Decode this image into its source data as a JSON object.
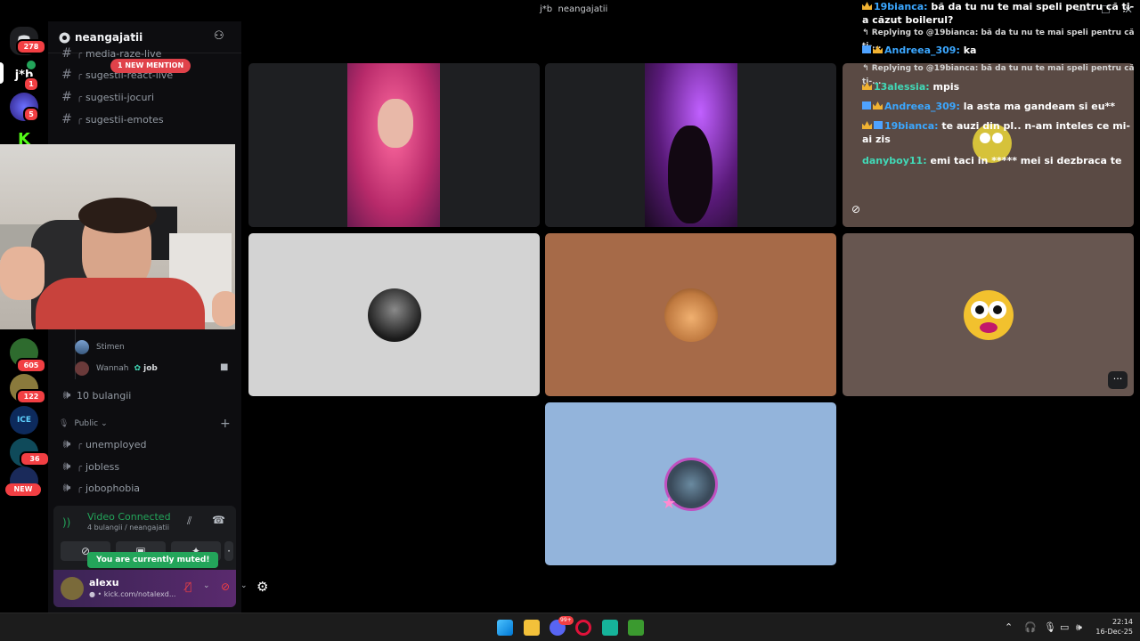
{
  "window": {
    "title": "neangajatii",
    "title_prefix": "j*b"
  },
  "rail": {
    "home_badge": "278",
    "servers": [
      {
        "label": "j*b",
        "badge": "1"
      },
      {
        "label": "",
        "badge": "5"
      },
      {
        "label": "K",
        "badge": ""
      },
      {
        "label": "",
        "badge": "605"
      },
      {
        "label": "",
        "badge": "122"
      },
      {
        "label": "ICE",
        "badge": ""
      },
      {
        "label": "",
        "badge": "36"
      }
    ],
    "new_label": "NEW"
  },
  "sidebar": {
    "server_name": "neangajatii",
    "mention_badge": "1 NEW MENTION",
    "channels": [
      {
        "name": "media-raze-live"
      },
      {
        "name": "sugestii-react-live"
      },
      {
        "name": "sugestii-jocuri"
      },
      {
        "name": "sugestii-emotes"
      }
    ],
    "voice_members": [
      {
        "name": "Stimen",
        "tag": ""
      },
      {
        "name": "Wannah",
        "tag": "job"
      }
    ],
    "voice_channel": "10 bulangii",
    "public_category": "Public",
    "public_channels": [
      {
        "name": "unemployed"
      },
      {
        "name": "jobless"
      },
      {
        "name": "jobophobia"
      }
    ]
  },
  "voice_panel": {
    "status": "Video Connected",
    "location": "4 bulangii / neangajatii",
    "tooltip": "You are currently muted!"
  },
  "user_panel": {
    "username": "alexu",
    "status": "kick.com/notalexd..."
  },
  "chat": {
    "lines": [
      {
        "type": "msg",
        "nick": "19bianca:",
        "text": "bă da tu nu te mai speli pentru că ți-a căzut boilerul?"
      },
      {
        "type": "reply",
        "text": "Replying to @19bianca: bă da tu nu te mai speli pentru că ți-..."
      },
      {
        "type": "msg",
        "nick": "Andreea_309:",
        "text": "ka"
      },
      {
        "type": "reply",
        "text": "Replying to @19bianca: bă da tu nu te mai speli pentru că ți-..."
      },
      {
        "type": "msg",
        "nick": "13alessia:",
        "text": "mpis"
      },
      {
        "type": "msg",
        "nick": "Andreea_309:",
        "text": "la asta ma gandeam si eu**"
      },
      {
        "type": "msg",
        "nick": "19bianca:",
        "text": "te auzi din pl.. n-am inteles ce mi-ai zis"
      },
      {
        "type": "msg",
        "nick": "danyboy11:",
        "text": "emi taci in ***** mei si dezbraca te"
      }
    ]
  },
  "taskbar": {
    "time": "22:14",
    "date": "16-Dec-25",
    "discord_badge": "99+"
  },
  "colors": {
    "tile_gray": "#d3d3d3",
    "tile_brown": "#a66a48",
    "tile_taupe": "#675650",
    "tile_blue": "#93b4db",
    "green_status": "#23a55a",
    "mention_red": "#e0424a"
  },
  "icons": [
    "gear-icon",
    "phone-hangup-icon",
    "mic-muted-icon",
    "camera-off-icon",
    "hash-icon",
    "speaker-icon",
    "add-member-icon",
    "more-icon",
    "windows-start-icon",
    "folder-icon",
    "discord-icon",
    "opera-icon",
    "minecraft-icon"
  ]
}
